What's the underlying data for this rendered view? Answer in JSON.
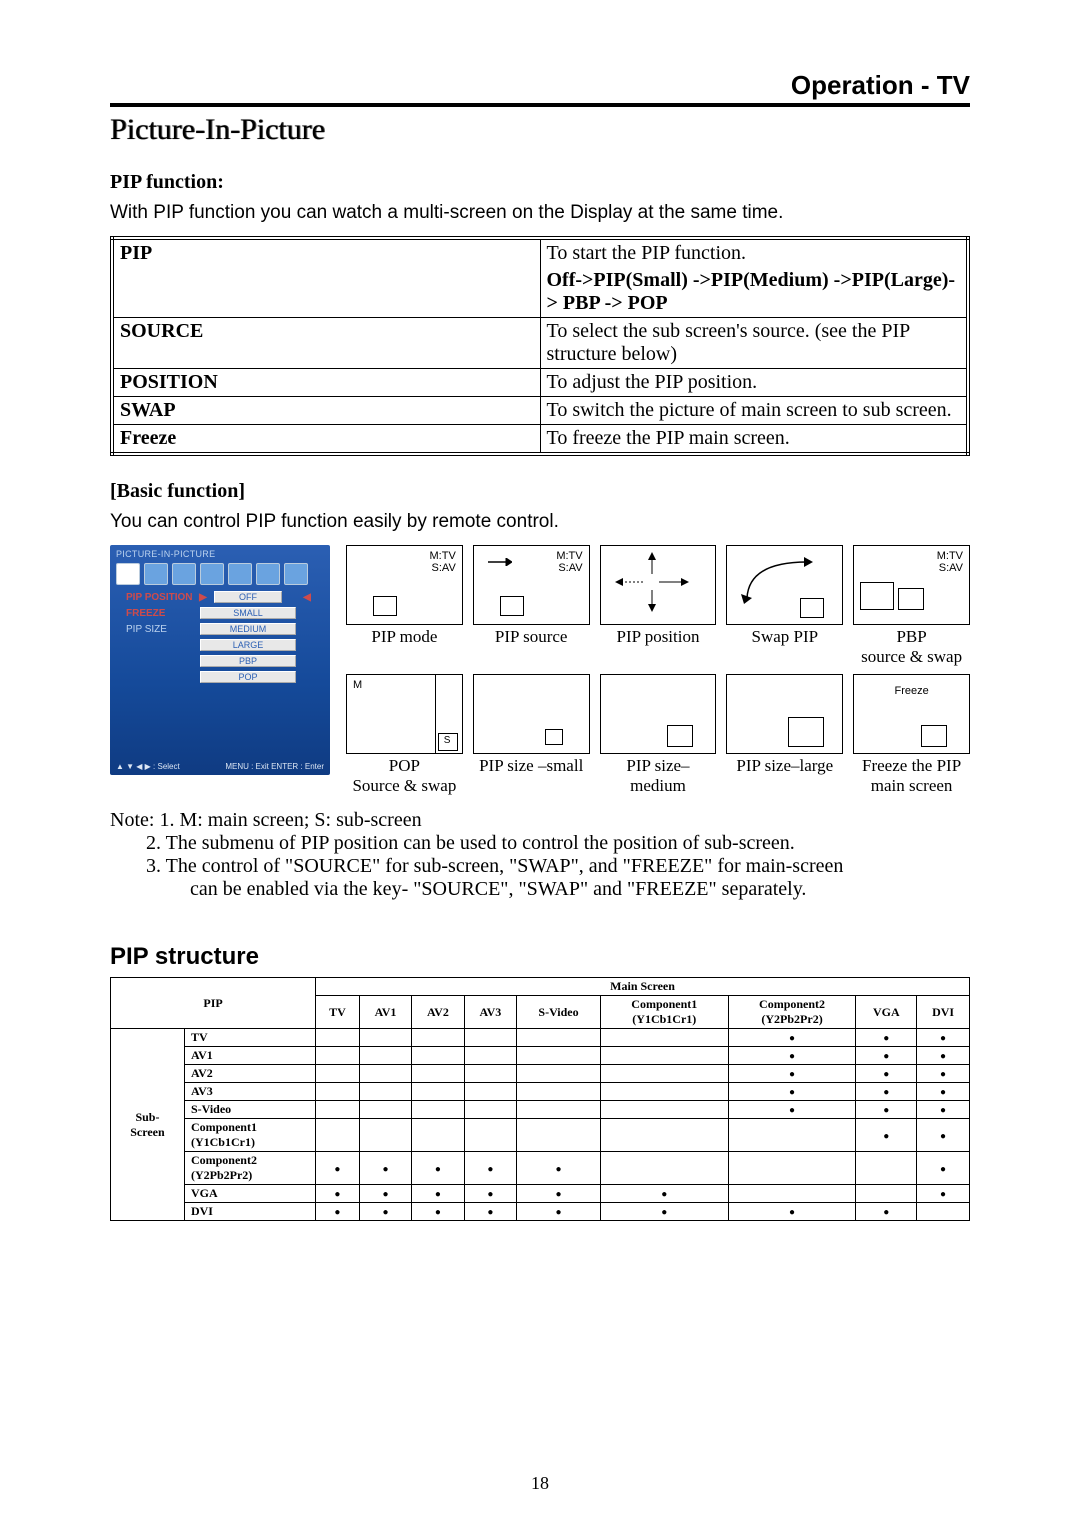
{
  "header": {
    "title": "Operation - TV"
  },
  "section_title": "Picture-In-Picture",
  "pip_function": {
    "heading": "PIP function:",
    "intro": "With PIP function you can watch a multi-screen on the Display at the same time."
  },
  "func_table": [
    {
      "term": "PIP",
      "desc_line1": "To start the PIP function.",
      "desc_line2": "Off->PIP(Small) ->PIP(Medium) ->PIP(Large)-> PBP -> POP"
    },
    {
      "term": "SOURCE",
      "desc_line1": "To select the sub screen's source. (see the PIP structure below)"
    },
    {
      "term": "POSITION",
      "desc_line1": "To adjust the PIP position."
    },
    {
      "term": "SWAP",
      "desc_line1": "To switch the picture of main screen to sub screen."
    },
    {
      "term": "Freeze",
      "desc_line1": "To freeze the PIP main screen."
    }
  ],
  "basic_function": {
    "heading": "[Basic function]",
    "intro": "You can control PIP function easily by remote control."
  },
  "osd": {
    "title": "PICTURE-IN-PICTURE",
    "rows": [
      {
        "label": "PIP POSITION",
        "value": "OFF",
        "highlight": true
      },
      {
        "label": "FREEZE",
        "value": "SMALL"
      },
      {
        "label": "PIP SIZE",
        "value": "MEDIUM"
      },
      {
        "label": "",
        "value": "LARGE"
      },
      {
        "label": "",
        "value": "PBP"
      },
      {
        "label": "",
        "value": "POP"
      }
    ],
    "footer_left": "▲ ▼ ◀ ▶ : Select",
    "footer_right": "MENU : Exit   ENTER : Enter"
  },
  "diagrams": {
    "row1": [
      {
        "caption": "PIP mode",
        "main_label": "M:TV",
        "sub_label": "S:AV"
      },
      {
        "caption": "PIP source",
        "main_label": "M:TV",
        "sub_label": "S:AV"
      },
      {
        "caption": "PIP position"
      },
      {
        "caption": "Swap PIP"
      },
      {
        "caption1": "PBP",
        "caption2": "source & swap",
        "main_label": "M:TV",
        "sub_label": "S:AV"
      }
    ],
    "row2": [
      {
        "caption1": "POP",
        "caption2": "Source & swap",
        "m": "M",
        "s": "S"
      },
      {
        "caption": "PIP size –small"
      },
      {
        "caption": "PIP size–medium"
      },
      {
        "caption": "PIP size–large"
      },
      {
        "caption1": "Freeze the PIP",
        "caption2": "main screen",
        "freeze": "Freeze"
      }
    ]
  },
  "notes": {
    "prefix": "Note:",
    "n1": "1. M: main screen; S: sub-screen",
    "n2": "2. The submenu of PIP position can be used to control the position of sub-screen.",
    "n3a": "3. The control of  \"SOURCE\" for sub-screen,  \"SWAP\", and  \"FREEZE\" for main-screen",
    "n3b": "can be enabled via the key- \"SOURCE\", \"SWAP\" and \"FREEZE\" separately."
  },
  "pip_structure": {
    "heading": "PIP structure",
    "top_header": "PIP",
    "main_screen": "Main Screen",
    "sub_screen": "Sub-\nScreen",
    "columns": [
      "TV",
      "AV1",
      "AV2",
      "AV3",
      "S-Video",
      "Component1\n(Y1Cb1Cr1)",
      "Component2\n(Y2Pb2Pr2)",
      "VGA",
      "DVI"
    ],
    "rows": [
      {
        "head": "TV",
        "d": [
          "",
          "",
          "",
          "",
          "",
          "",
          "Y",
          "Y",
          "Y"
        ]
      },
      {
        "head": "AV1",
        "d": [
          "",
          "",
          "",
          "",
          "",
          "",
          "Y",
          "Y",
          "Y"
        ]
      },
      {
        "head": "AV2",
        "d": [
          "",
          "",
          "",
          "",
          "",
          "",
          "Y",
          "Y",
          "Y"
        ]
      },
      {
        "head": "AV3",
        "d": [
          "",
          "",
          "",
          "",
          "",
          "",
          "Y",
          "Y",
          "Y"
        ]
      },
      {
        "head": "S-Video",
        "d": [
          "",
          "",
          "",
          "",
          "",
          "",
          "Y",
          "Y",
          "Y"
        ]
      },
      {
        "head": "Component1\n(Y1Cb1Cr1)",
        "d": [
          "",
          "",
          "",
          "",
          "",
          "",
          "",
          "Y",
          "Y"
        ]
      },
      {
        "head": "Component2\n(Y2Pb2Pr2)",
        "d": [
          "Y",
          "Y",
          "Y",
          "Y",
          "Y",
          "",
          "",
          "",
          "Y"
        ]
      },
      {
        "head": "VGA",
        "d": [
          "Y",
          "Y",
          "Y",
          "Y",
          "Y",
          "Y",
          "",
          "",
          "Y"
        ]
      },
      {
        "head": "DVI",
        "d": [
          "Y",
          "Y",
          "Y",
          "Y",
          "Y",
          "Y",
          "Y",
          "Y",
          ""
        ]
      }
    ]
  },
  "page_number": "18"
}
